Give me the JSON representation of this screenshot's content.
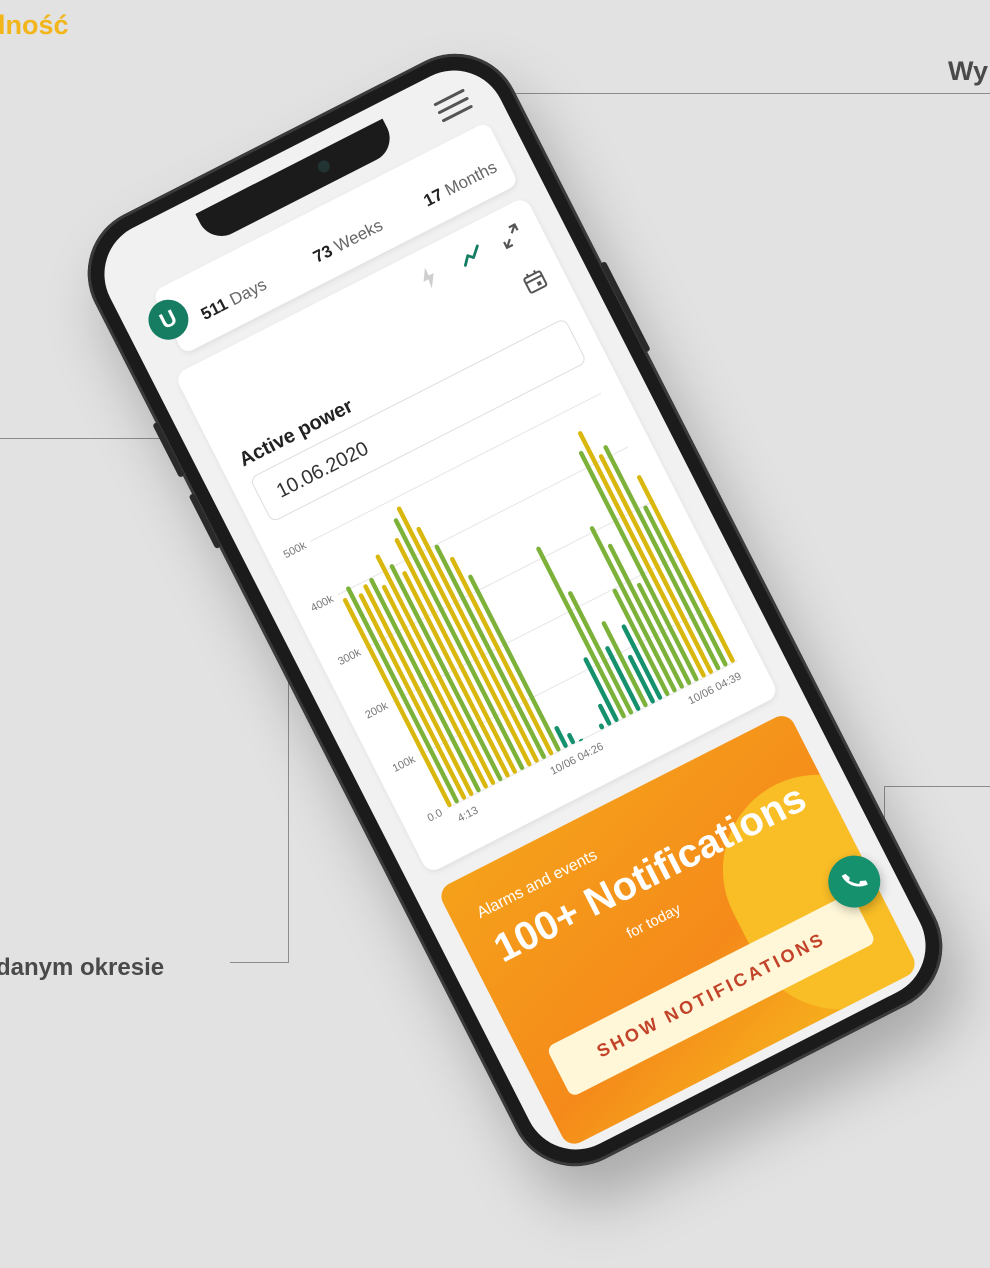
{
  "annotations": {
    "top_left": "lność",
    "top_right": "Wy",
    "bottom_left": "danym okresie"
  },
  "stats": {
    "days_value": "511",
    "days_label": "Days",
    "weeks_value": "73",
    "weeks_label": "Weeks",
    "months_value": "17",
    "months_label": "Months"
  },
  "logo": {
    "letter": "U"
  },
  "chart_card": {
    "title": "Active power",
    "date": "10.06.2020"
  },
  "chart_data": {
    "type": "bar",
    "title": "",
    "xlabel": "",
    "ylabel": "",
    "ylim": [
      0,
      500000
    ],
    "y_ticks": [
      "0.0",
      "100k",
      "200k",
      "300k",
      "400k",
      "500k"
    ],
    "x_tick_labels": [
      "4:13",
      "10/06 04:26",
      "10/06 04:39"
    ],
    "values": [
      390000,
      405000,
      385000,
      395000,
      400000,
      380000,
      430000,
      405000,
      385000,
      440000,
      470000,
      485000,
      440000,
      400000,
      370000,
      330000,
      40000,
      20000,
      2000,
      0,
      0,
      10000,
      40000,
      120000,
      320000,
      230000,
      120000,
      160000,
      90000,
      140000,
      200000,
      310000,
      270000,
      190000,
      430000,
      460000,
      410000,
      420000,
      300000,
      350000
    ]
  },
  "alarms": {
    "subtitle": "Alarms and events",
    "title": "100+ Notifications",
    "today": "for today",
    "button": "SHOW NOTIFICATIONS"
  },
  "icons": {
    "menu": "hamburger-menu-icon",
    "bolt": "bolt-icon",
    "trend": "trend-line-icon",
    "expand": "expand-icon",
    "calendar": "calendar-icon",
    "call": "phone-call-icon"
  },
  "colors": {
    "brand_green": "#167d63",
    "bar_yellow": "#d9b70c",
    "bar_green": "#7db23a",
    "bar_teal": "#15916e",
    "alarm_orange": "#f58a1a",
    "annotation_yellow": "#f2b51a"
  }
}
